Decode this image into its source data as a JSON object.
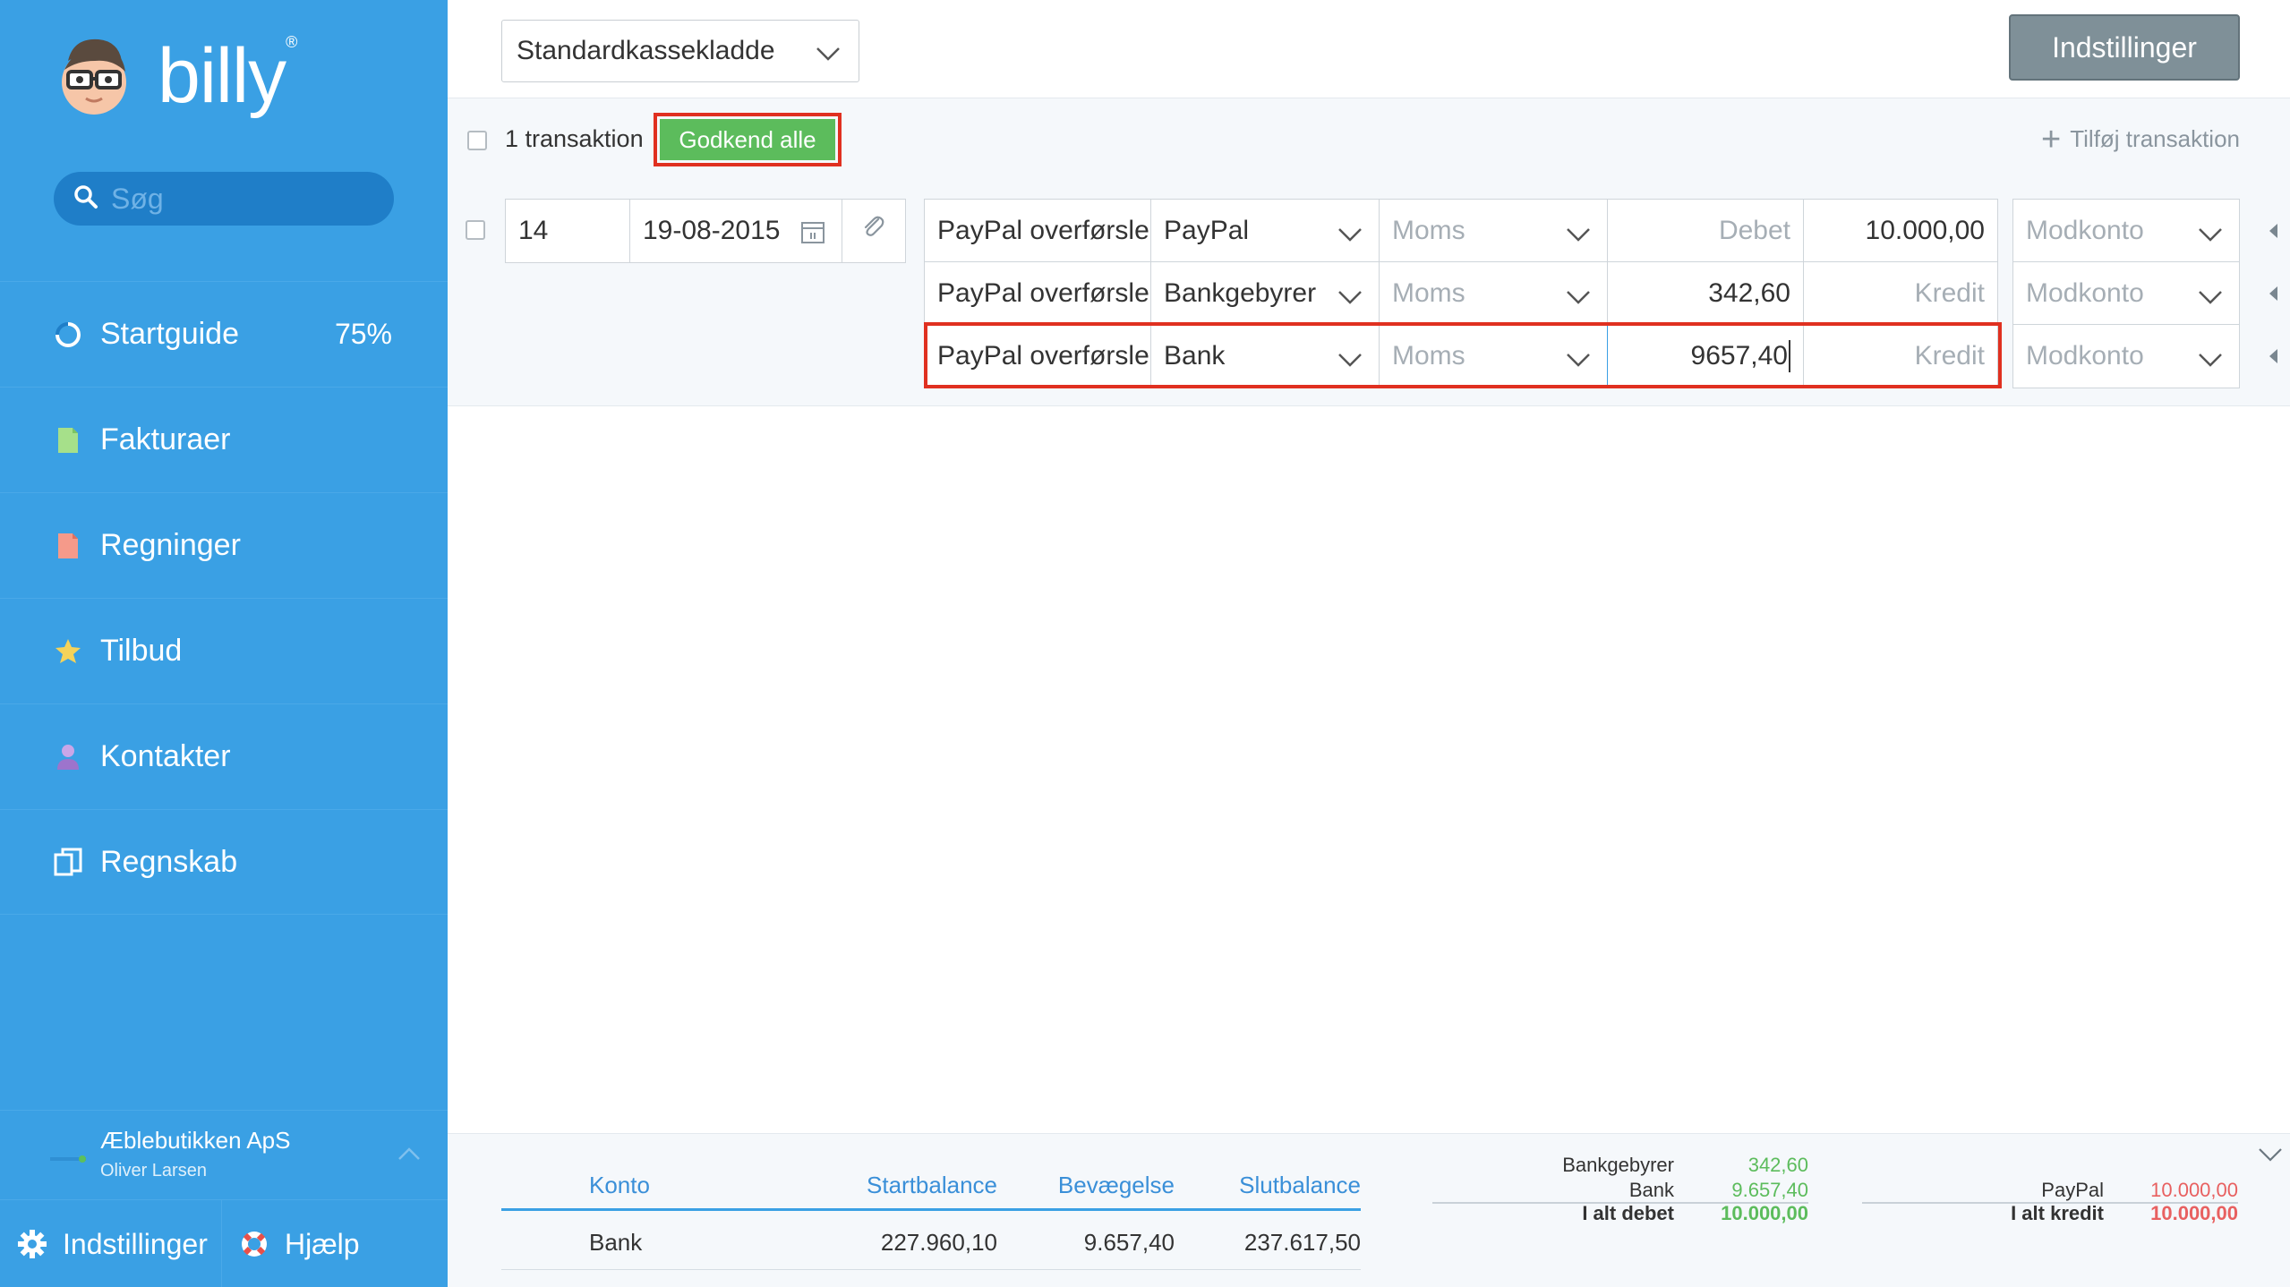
{
  "app": {
    "name": "billy",
    "registered": "®"
  },
  "sidebar": {
    "search_placeholder": "Søg",
    "items": [
      {
        "label": "Startguide",
        "extra": "75%"
      },
      {
        "label": "Fakturaer"
      },
      {
        "label": "Regninger"
      },
      {
        "label": "Tilbud"
      },
      {
        "label": "Kontakter"
      },
      {
        "label": "Regnskab"
      }
    ],
    "company": {
      "name": "Æblebutikken ApS",
      "user": "Oliver Larsen"
    },
    "bottom": {
      "settings": "Indstillinger",
      "help": "Hjælp"
    }
  },
  "header": {
    "daybook": "Standardkassekladde",
    "settings_button": "Indstillinger"
  },
  "toolbar": {
    "count_label": "1 transaktion",
    "approve_all": "Godkend alle",
    "add_transaction": "Tilføj transaktion"
  },
  "transaction": {
    "number": "14",
    "date": "19-08-2015",
    "lines": [
      {
        "text": "PayPal overførsle",
        "account": "PayPal",
        "vat_placeholder": "Moms",
        "debit": "",
        "debit_placeholder": "Debet",
        "credit": "10.000,00",
        "credit_placeholder": "Kredit",
        "contra_placeholder": "Modkonto"
      },
      {
        "text": "PayPal overførsle",
        "account": "Bankgebyrer",
        "vat_placeholder": "Moms",
        "debit": "342,60",
        "debit_placeholder": "Debet",
        "credit": "",
        "credit_placeholder": "Kredit",
        "contra_placeholder": "Modkonto"
      },
      {
        "text": "PayPal overførsle",
        "account": "Bank",
        "vat_placeholder": "Moms",
        "debit": "9657,40",
        "debit_placeholder": "Debet",
        "credit": "",
        "credit_placeholder": "Kredit",
        "contra_placeholder": "Modkonto"
      }
    ]
  },
  "summary": {
    "headers": {
      "account": "Konto",
      "start": "Startbalance",
      "movement": "Bevægelse",
      "end": "Slutbalance"
    },
    "rows": [
      {
        "account": "Bank",
        "start": "227.960,10",
        "movement": "9.657,40",
        "end": "237.617,50"
      }
    ],
    "debit": {
      "lines": [
        {
          "label": "Bankgebyrer",
          "value": "342,60"
        },
        {
          "label": "Bank",
          "value": "9.657,40"
        }
      ],
      "total_label": "I alt debet",
      "total_value": "10.000,00"
    },
    "credit": {
      "lines": [
        {
          "label": "PayPal",
          "value": "10.000,00"
        }
      ],
      "total_label": "I alt kredit",
      "total_value": "10.000,00"
    }
  },
  "colors": {
    "sidebar": "#3aa0e4",
    "approve": "#5cbc5c",
    "highlight": "#e03020",
    "debit": "#5cbc5c",
    "credit": "#e86060"
  }
}
